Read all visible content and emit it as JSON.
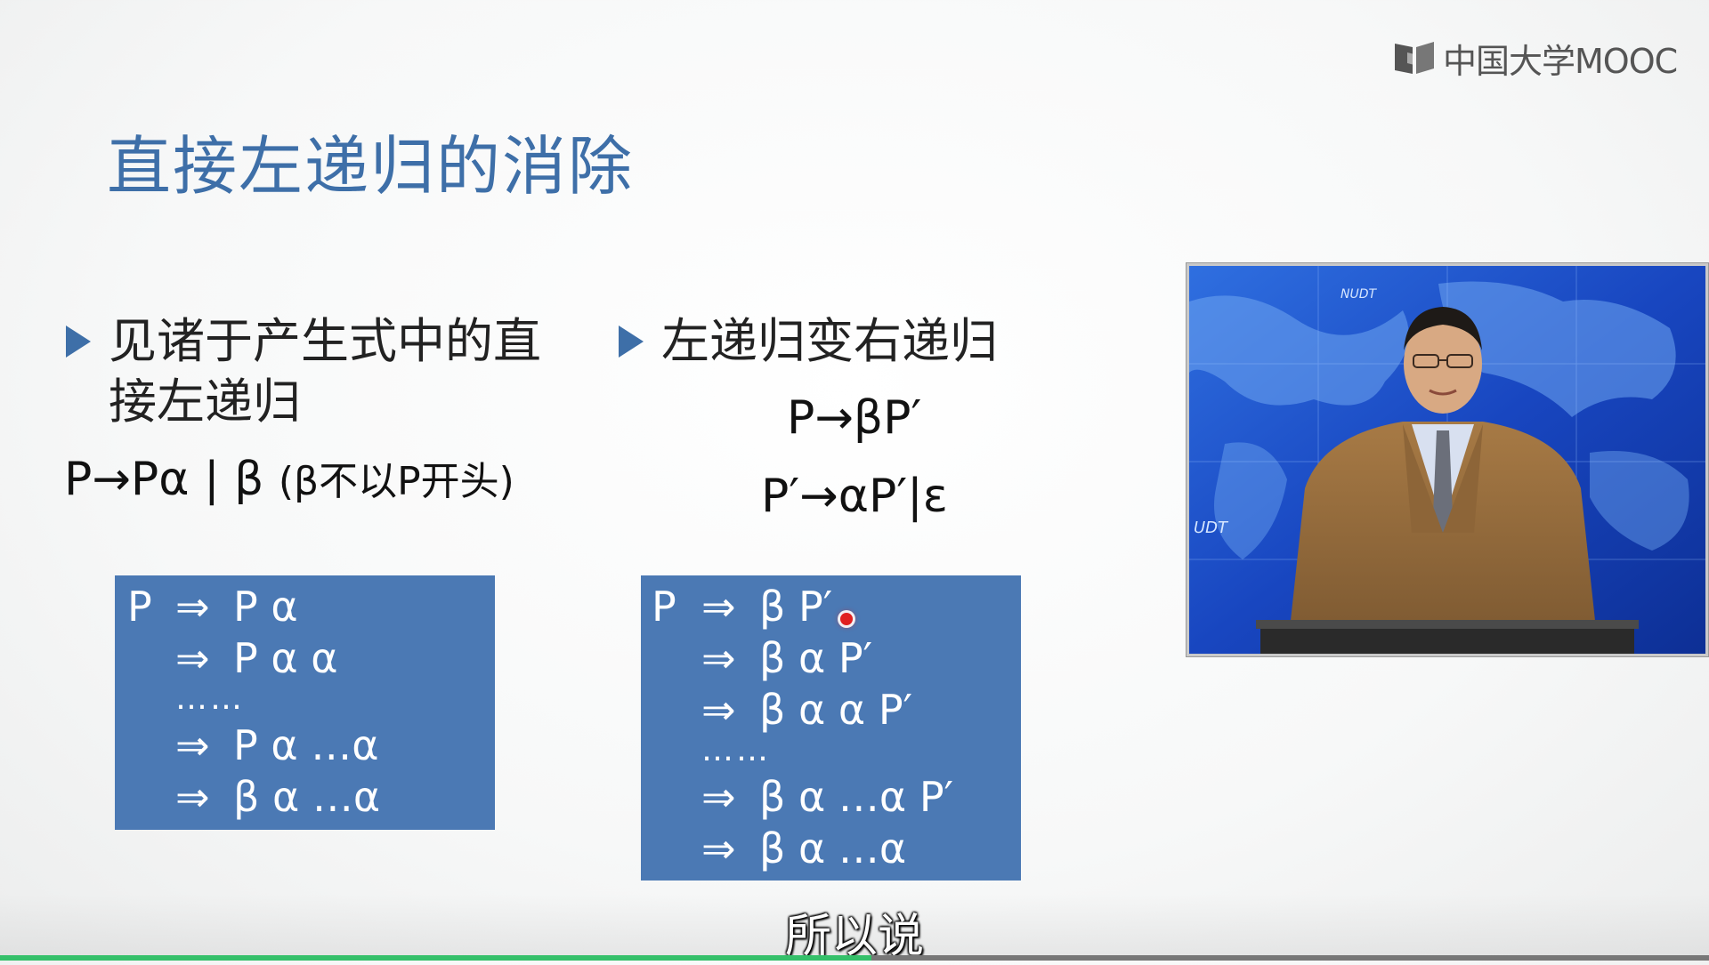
{
  "brand": {
    "name": "中国大学MOOC",
    "icon": "book-logo-icon"
  },
  "slide": {
    "title": "直接左递归的消除",
    "left_bullet": "见诸于产生式中的直接左递归",
    "left_formula_main": "P→Pα | β",
    "left_formula_note": "(β不以P开头)",
    "right_bullet": "左递归变右递归",
    "right_formula_1": "P→βP′",
    "right_formula_2": "P′→αP′|ε",
    "left_derivation": [
      {
        "lhs": "P",
        "arrow": "⇒",
        "rhs": "P α"
      },
      {
        "lhs": "",
        "arrow": "⇒",
        "rhs": "P α α"
      },
      {
        "lhs": "",
        "arrow": "",
        "rhs": "……"
      },
      {
        "lhs": "",
        "arrow": "⇒",
        "rhs": "P α …α"
      },
      {
        "lhs": "",
        "arrow": "⇒",
        "rhs": "β α …α"
      }
    ],
    "right_derivation": [
      {
        "lhs": "P",
        "arrow": "⇒",
        "rhs": "β P′"
      },
      {
        "lhs": "",
        "arrow": "⇒",
        "rhs": "β α P′"
      },
      {
        "lhs": "",
        "arrow": "⇒",
        "rhs": "β α α P′"
      },
      {
        "lhs": "",
        "arrow": "",
        "rhs": "……"
      },
      {
        "lhs": "",
        "arrow": "⇒",
        "rhs": "β α …α P′"
      },
      {
        "lhs": "",
        "arrow": "⇒",
        "rhs": "β α …α"
      }
    ]
  },
  "video": {
    "backdrop_text_1": "NUDT",
    "backdrop_text_2": "UDT"
  },
  "player": {
    "subtitle": "所以说",
    "progress": 0.51,
    "progress_color": "#35c06a"
  }
}
